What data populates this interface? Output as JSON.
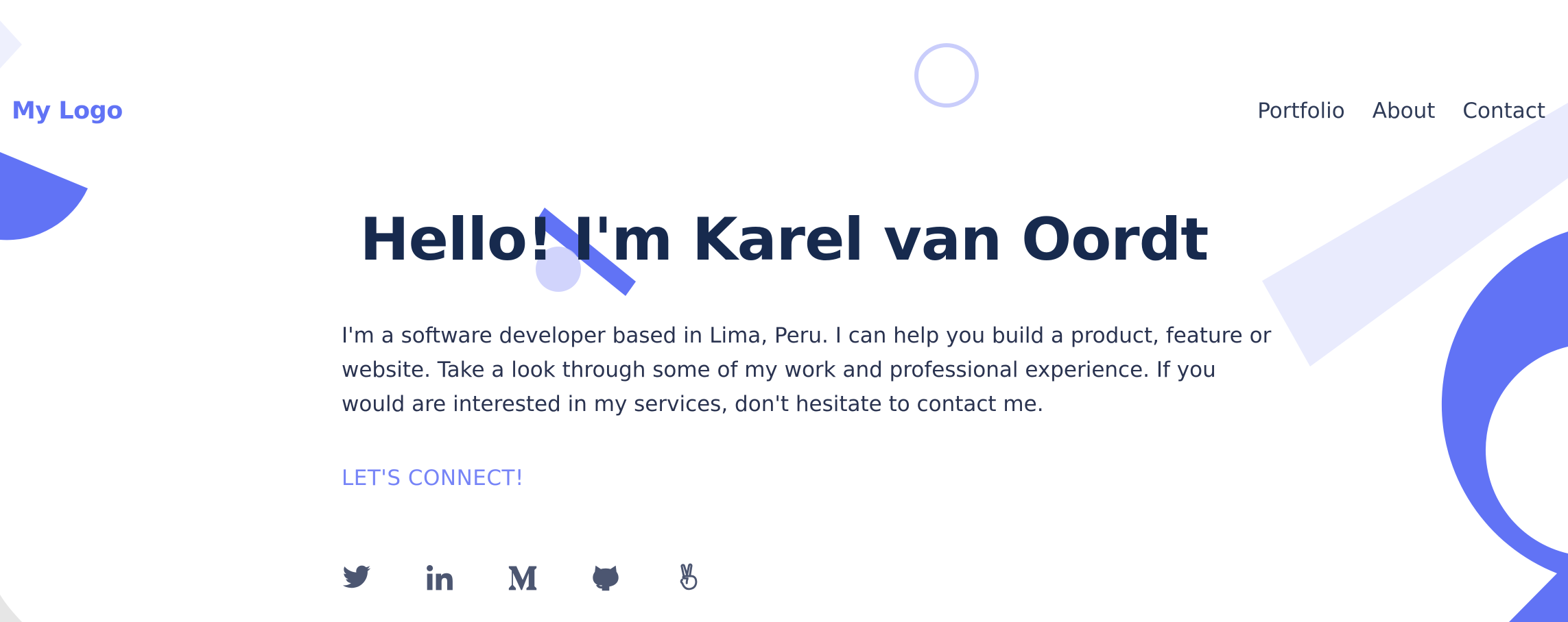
{
  "header": {
    "logo": "My Logo",
    "nav": [
      {
        "label": "Portfolio"
      },
      {
        "label": "About"
      },
      {
        "label": "Contact"
      }
    ]
  },
  "hero": {
    "title": "Hello! I'm Karel van Oordt",
    "intro": "I'm a software developer based in Lima, Peru. I can help you build a product, feature or website. Take a look through some of my work and professional experience. If you would are interested in my services, don't hesitate to contact me.",
    "cta": "LET'S CONNECT!"
  },
  "social": [
    {
      "icon": "twitter-icon"
    },
    {
      "icon": "linkedin-icon"
    },
    {
      "icon": "medium-icon"
    },
    {
      "icon": "github-icon"
    },
    {
      "icon": "angellist-icon"
    }
  ],
  "colors": {
    "accent": "#6173f5",
    "accent_light": "#e9ebfd",
    "heading": "#172a4e",
    "text": "#2a3350",
    "social_icon": "#4c5671"
  }
}
